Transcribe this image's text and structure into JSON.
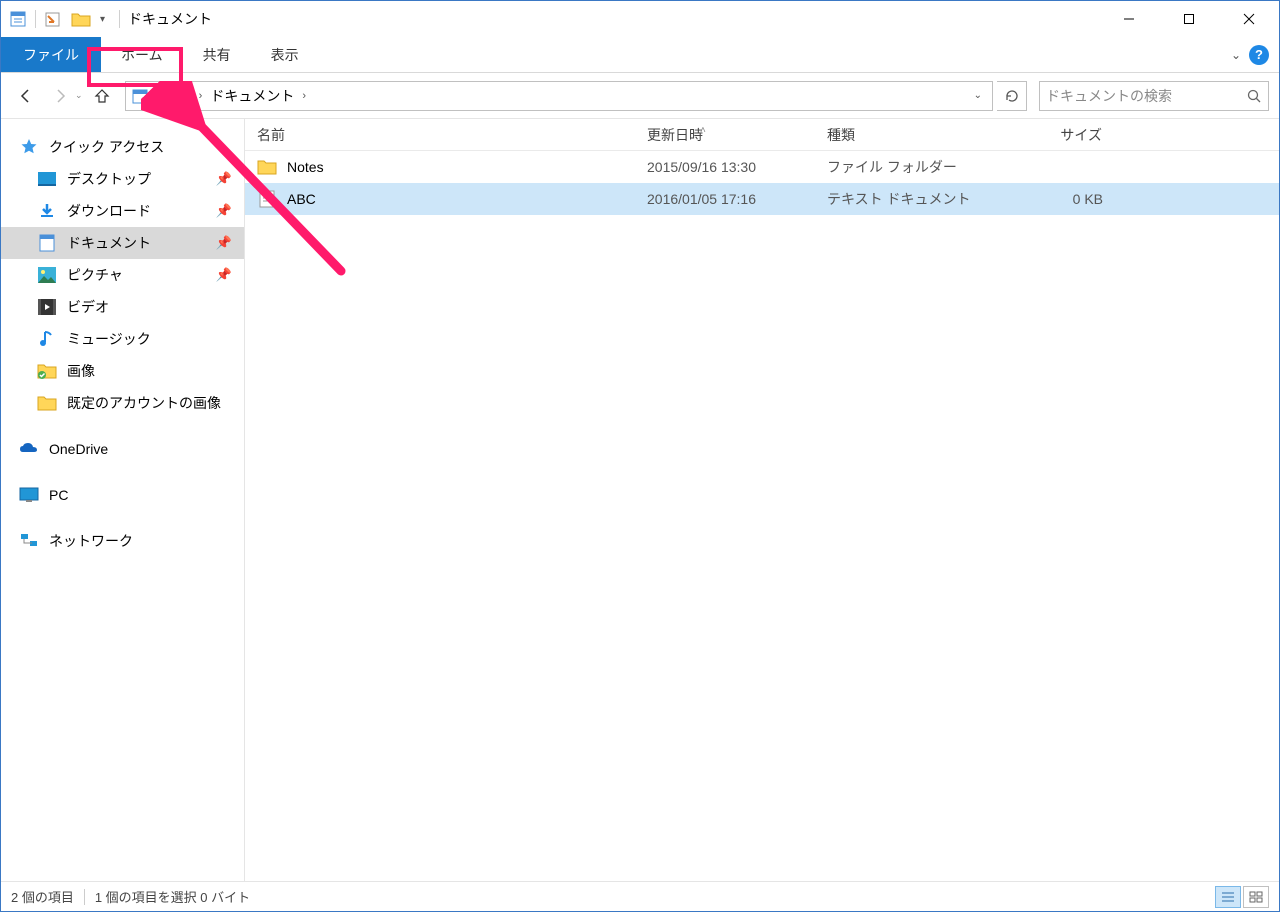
{
  "window": {
    "title": "ドキュメント"
  },
  "ribbon": {
    "file": "ファイル",
    "home": "ホーム",
    "share": "共有",
    "view": "表示"
  },
  "nav": {
    "breadcrumb": {
      "pc": "PC",
      "folder": "ドキュメント"
    },
    "search_placeholder": "ドキュメントの検索"
  },
  "sidebar": {
    "quick_access": "クイック アクセス",
    "items": [
      {
        "label": "デスクトップ",
        "pinned": true
      },
      {
        "label": "ダウンロード",
        "pinned": true
      },
      {
        "label": "ドキュメント",
        "pinned": true,
        "selected": true
      },
      {
        "label": "ピクチャ",
        "pinned": true
      },
      {
        "label": "ビデオ",
        "pinned": false
      },
      {
        "label": "ミュージック",
        "pinned": false
      },
      {
        "label": "画像",
        "pinned": false
      },
      {
        "label": "既定のアカウントの画像",
        "pinned": false
      }
    ],
    "onedrive": "OneDrive",
    "pc": "PC",
    "network": "ネットワーク"
  },
  "columns": {
    "name": "名前",
    "date": "更新日時",
    "type": "種類",
    "size": "サイズ"
  },
  "files": [
    {
      "name": "Notes",
      "date": "2015/09/16 13:30",
      "type": "ファイル フォルダー",
      "size": "",
      "kind": "folder",
      "selected": false
    },
    {
      "name": "ABC",
      "date": "2016/01/05 17:16",
      "type": "テキスト ドキュメント",
      "size": "0 KB",
      "kind": "text",
      "selected": true
    }
  ],
  "status": {
    "count": "2 個の項目",
    "selection": "1 個の項目を選択 0 バイト"
  }
}
